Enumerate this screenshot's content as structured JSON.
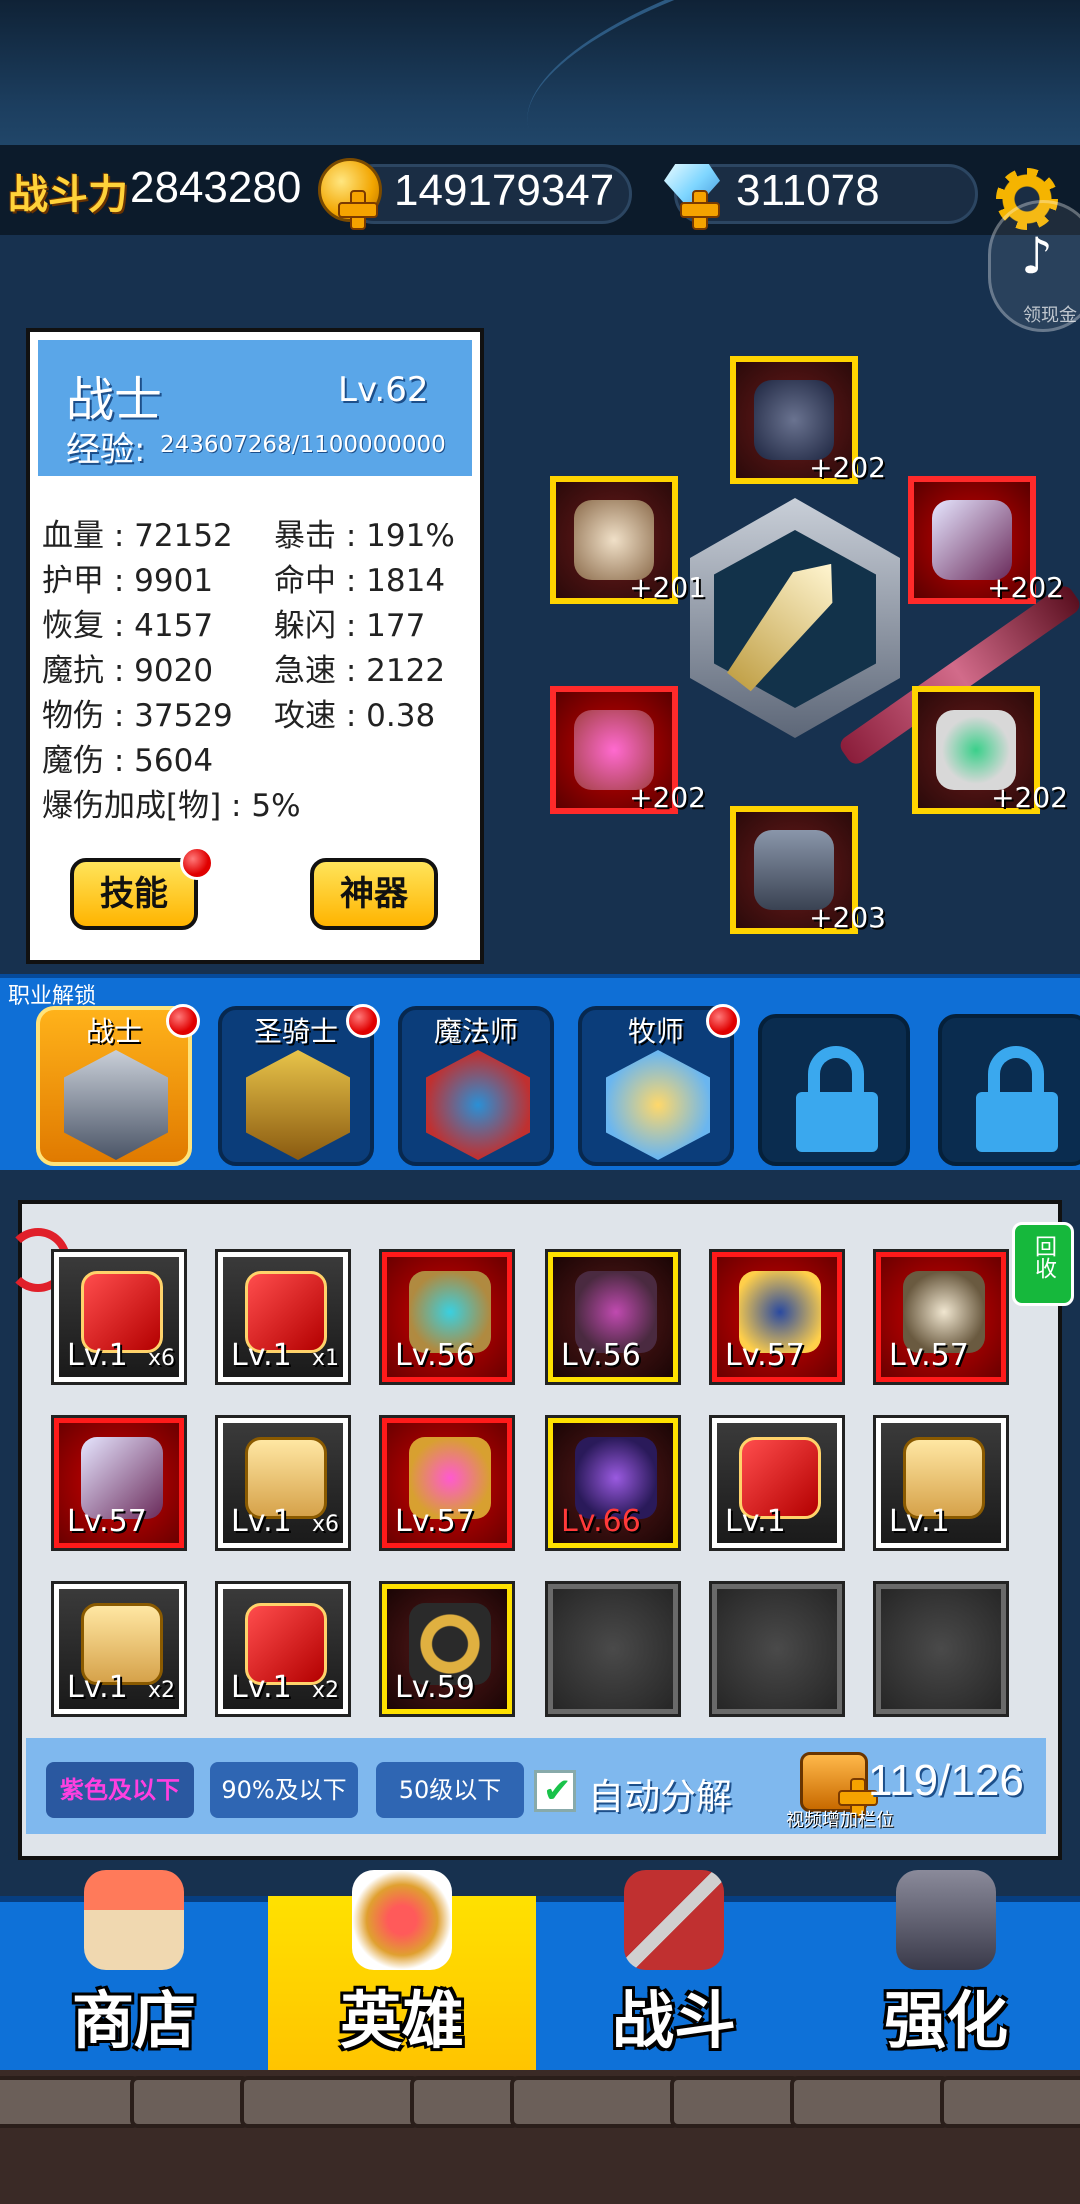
{
  "header": {
    "power_label": "战斗力",
    "power_value": "2843280",
    "gold": "149179347",
    "diamonds": "311078",
    "tiktok_label": "领现金"
  },
  "hero": {
    "name": "战士",
    "level": "Lv.62",
    "exp_label": "经验:",
    "exp_value": "243607268/1100000000",
    "stats": [
      {
        "label": "血量 : 72152"
      },
      {
        "label": "暴击 : 191%"
      },
      {
        "label": "护甲 : 9901"
      },
      {
        "label": "命中 : 1814"
      },
      {
        "label": "恢复 : 4157"
      },
      {
        "label": "躲闪 : 177"
      },
      {
        "label": "魔抗 : 9020"
      },
      {
        "label": "急速 : 2122"
      },
      {
        "label": "物伤 : 37529"
      },
      {
        "label": "攻速 : 0.38"
      },
      {
        "label": "魔伤 : 5604"
      },
      {
        "label": "爆伤加成[物] : 5%"
      }
    ],
    "skill_button": "技能",
    "artifact_button": "神器"
  },
  "equipment": [
    {
      "name": "helmet",
      "plus": "+202"
    },
    {
      "name": "armor",
      "plus": "+201"
    },
    {
      "name": "weapon",
      "plus": "+202"
    },
    {
      "name": "chalice",
      "plus": "+202"
    },
    {
      "name": "ring",
      "plus": "+202"
    },
    {
      "name": "boots",
      "plus": "+203"
    }
  ],
  "classes": {
    "unlock_label": "职业解锁",
    "items": [
      {
        "label": "战士"
      },
      {
        "label": "圣骑士"
      },
      {
        "label": "魔法师"
      },
      {
        "label": "牧师"
      }
    ]
  },
  "inventory": {
    "recycle_label": "回收",
    "slots": [
      {
        "level": "Lv.1",
        "count": "x6"
      },
      {
        "level": "Lv.1",
        "count": "x1"
      },
      {
        "level": "Lv.56",
        "count": ""
      },
      {
        "level": "Lv.56",
        "count": ""
      },
      {
        "level": "Lv.57",
        "count": ""
      },
      {
        "level": "Lv.57",
        "count": ""
      },
      {
        "level": "Lv.57",
        "count": ""
      },
      {
        "level": "Lv.1",
        "count": "x6"
      },
      {
        "level": "Lv.57",
        "count": ""
      },
      {
        "level": "Lv.66",
        "count": ""
      },
      {
        "level": "Lv.1",
        "count": ""
      },
      {
        "level": "Lv.1",
        "count": ""
      },
      {
        "level": "Lv.1",
        "count": "x2"
      },
      {
        "level": "Lv.1",
        "count": "x2"
      },
      {
        "level": "Lv.59",
        "count": ""
      }
    ],
    "filters": [
      "紫色及以下",
      "90%及以下",
      "50级以下"
    ],
    "auto_decompose": "自动分解",
    "capacity": "119/126",
    "capacity_note": "视频增加栏位"
  },
  "nav": [
    {
      "label": "商店"
    },
    {
      "label": "英雄"
    },
    {
      "label": "战斗"
    },
    {
      "label": "强化"
    }
  ],
  "colors": {
    "accent_gold": "#ffd23a",
    "nav_selected": "#ffe100",
    "filter_selected": "#ff3fe0"
  }
}
